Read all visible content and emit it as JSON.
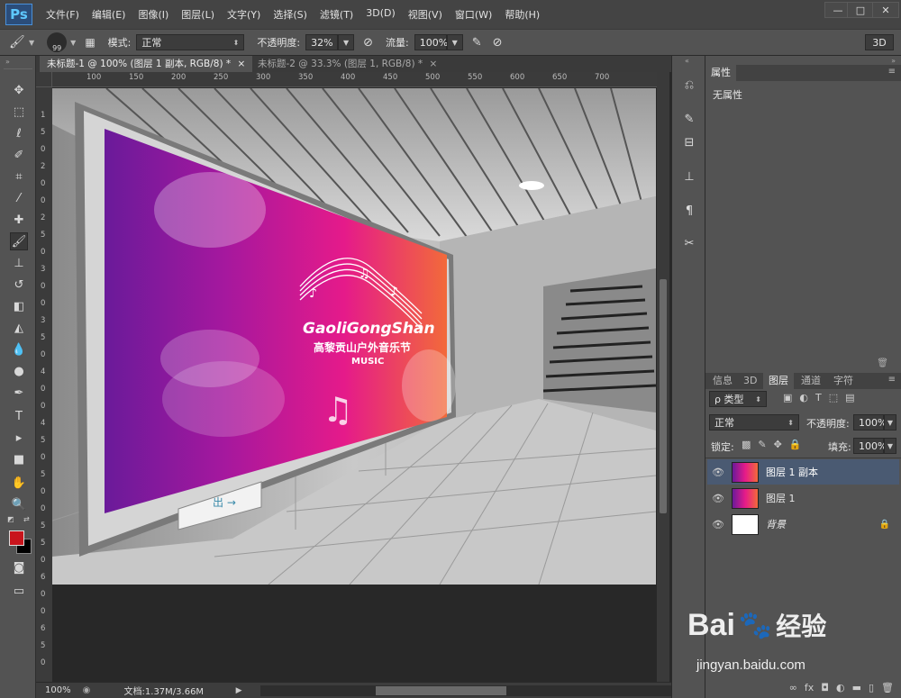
{
  "app": {
    "logo": "Ps"
  },
  "menu": [
    "文件(F)",
    "编辑(E)",
    "图像(I)",
    "图层(L)",
    "文字(Y)",
    "选择(S)",
    "滤镜(T)",
    "3D(D)",
    "视图(V)",
    "窗口(W)",
    "帮助(H)"
  ],
  "window_controls": {
    "minimize": "—",
    "maximize": "□",
    "close": "✕"
  },
  "options": {
    "brush_size": "99",
    "mode_label": "模式:",
    "mode_value": "正常",
    "opacity_label": "不透明度:",
    "opacity_value": "32%",
    "flow_label": "流量:",
    "flow_value": "100%",
    "workspace": "3D"
  },
  "tabs": [
    {
      "label": "未标题-1 @ 100% (图层 1 副本, RGB/8) *",
      "close": "×"
    },
    {
      "label": "未标题-2 @ 33.3% (图层 1, RGB/8) *",
      "close": "×"
    }
  ],
  "ruler_top": [
    "100",
    "150",
    "200",
    "250",
    "300",
    "350",
    "400",
    "450",
    "500",
    "550",
    "600",
    "650",
    "700"
  ],
  "ruler_left": [
    "1",
    "5",
    "0",
    "2",
    "0",
    "0",
    "2",
    "5",
    "0",
    "3",
    "0",
    "0",
    "3",
    "5",
    "0",
    "4",
    "0",
    "0",
    "4",
    "5",
    "0",
    "5",
    "0",
    "0",
    "5",
    "5",
    "0",
    "6",
    "0",
    "0",
    "6",
    "5",
    "0"
  ],
  "billboard": {
    "brand": "GaoliGongShan",
    "subtitle": "高黎贡山户外音乐节",
    "music": "MUSIC",
    "sign": "出 →"
  },
  "status": {
    "zoom": "100%",
    "doc": "文档:1.37M/3.66M"
  },
  "properties": {
    "tab": "属性",
    "empty": "无属性"
  },
  "layers_panel": {
    "tabs": [
      "信息",
      "3D",
      "图层",
      "通道",
      "字符"
    ],
    "filter_label": "ρ 类型",
    "blend_mode": "正常",
    "opacity_label": "不透明度:",
    "opacity_value": "100%",
    "lock_label": "锁定:",
    "fill_label": "填充:",
    "fill_value": "100%",
    "layers": [
      {
        "name": "图层 1 副本",
        "selected": true
      },
      {
        "name": "图层 1",
        "selected": false
      },
      {
        "name": "背景",
        "selected": false,
        "locked": true
      }
    ]
  },
  "watermark": {
    "brand": "Bai",
    "brand2": "经验",
    "url": "jingyan.baidu.com"
  },
  "colors": {
    "foreground": "#c8141c",
    "background": "#000000",
    "selected_layer": "#4a5a72"
  }
}
